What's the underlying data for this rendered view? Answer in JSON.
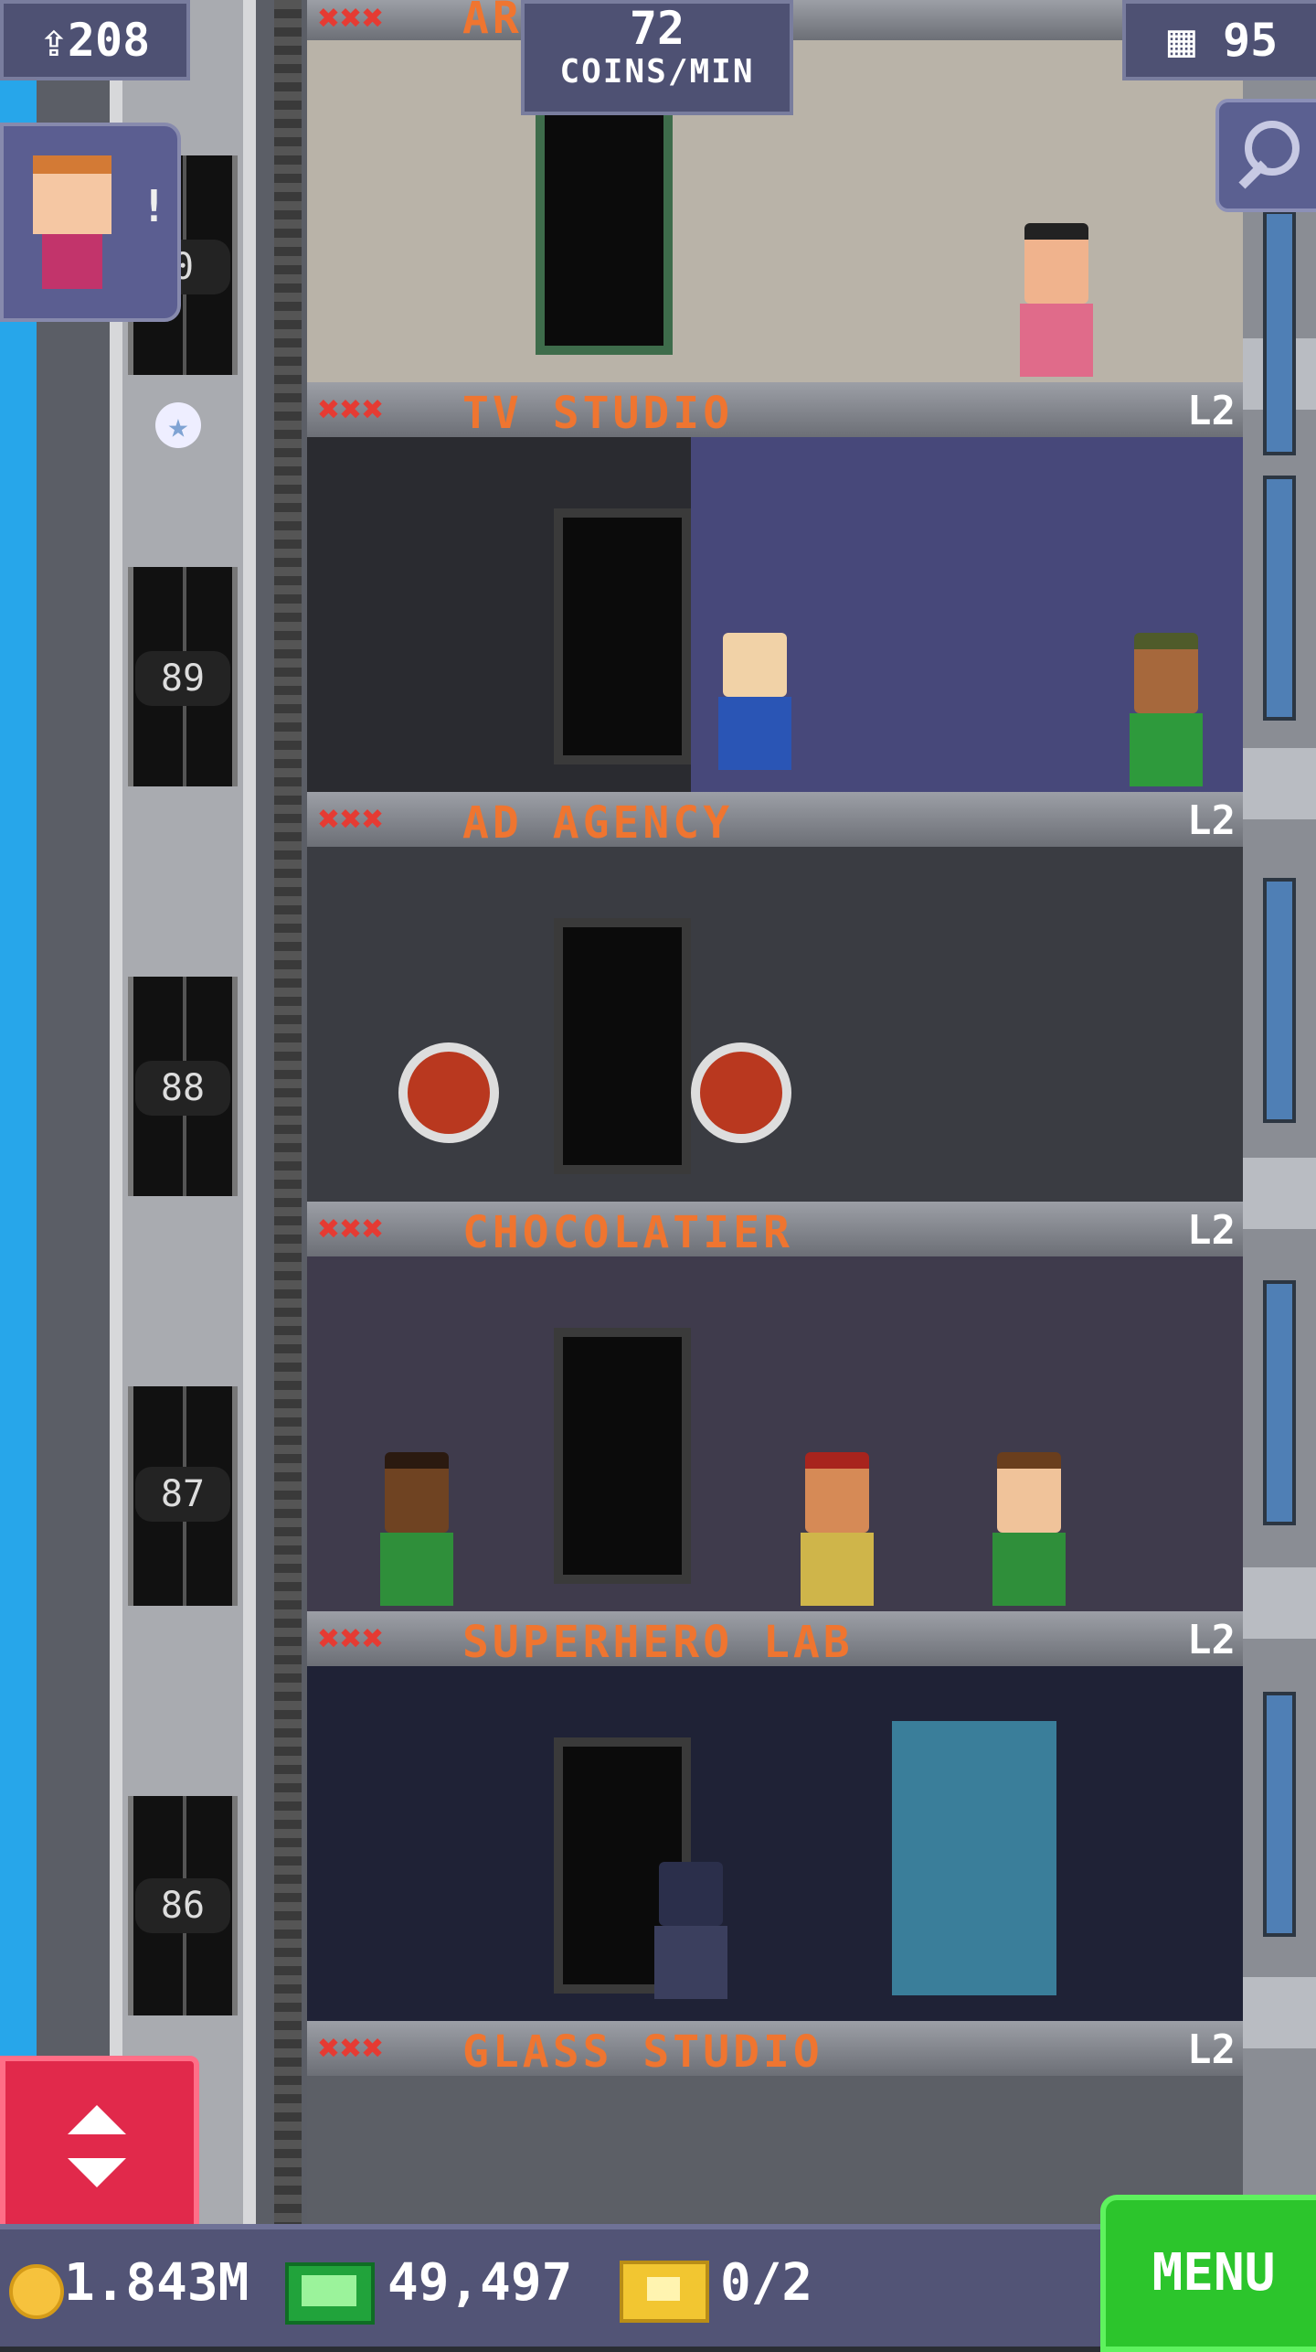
{
  "hud": {
    "population": "208",
    "coins_per_min_value": "72",
    "coins_per_min_unit": "COINS/MIN",
    "floor_count": "95",
    "avatar_notice": "!"
  },
  "top_floor_label_partial": "AR",
  "elevator": {
    "floor_numbers": [
      "0",
      "89",
      "88",
      "87",
      "86"
    ]
  },
  "floors": [
    {
      "name": "TV STUDIO",
      "level": "L2",
      "rating": "✖✖✖"
    },
    {
      "name": "AD AGENCY",
      "level": "L2",
      "rating": "✖✖✖"
    },
    {
      "name": "CHOCOLATIER",
      "level": "L2",
      "rating": "✖✖✖"
    },
    {
      "name": "SUPERHERO LAB",
      "level": "L2",
      "rating": "✖✖✖"
    },
    {
      "name": "GLASS STUDIO",
      "level": "L2",
      "rating": "✖✖✖"
    }
  ],
  "bottom_bar": {
    "coins": "1.843M",
    "bux": "49,497",
    "tickets": "0/2",
    "menu_label": "MENU"
  },
  "colors": {
    "floor_name": "#ef7530",
    "rating": "#e53b33",
    "hud_bg": "#4e5173",
    "menu_bg": "#2cc52c",
    "elevator_button": "#e1294b"
  },
  "icons": [
    "population-icon",
    "floors-icon",
    "search-icon",
    "coin-icon",
    "bux-icon",
    "ticket-icon",
    "elevator-arrows-icon"
  ]
}
